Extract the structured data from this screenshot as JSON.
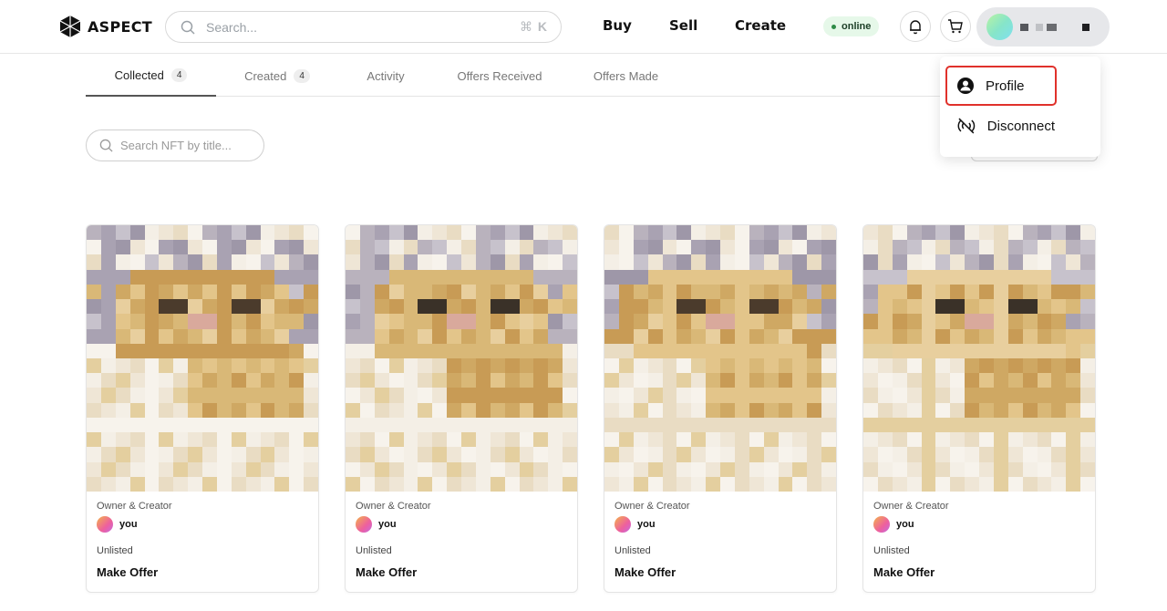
{
  "brand": {
    "name": "ASPECT"
  },
  "search": {
    "placeholder": "Search...",
    "shortcut_symbol": "⌘",
    "shortcut_key": "K"
  },
  "nav": {
    "buy": "Buy",
    "sell": "Sell",
    "create": "Create"
  },
  "status": {
    "label": "online",
    "color": "#2e8b46"
  },
  "account": {
    "avatar_gradient": [
      "#b9f3a3",
      "#7ee0f0"
    ]
  },
  "tabs": [
    {
      "label": "Collected",
      "count": "4",
      "active": true
    },
    {
      "label": "Created",
      "count": "4"
    },
    {
      "label": "Activity"
    },
    {
      "label": "Offers Received"
    },
    {
      "label": "Offers Made"
    }
  ],
  "nft_search": {
    "placeholder": "Search NFT by title..."
  },
  "account_menu": {
    "items": [
      {
        "label": "Profile",
        "icon": "user-circle-icon"
      },
      {
        "label": "Disconnect",
        "icon": "disconnect-icon"
      }
    ],
    "highlight_color": "#e0312b"
  },
  "cards": [
    {
      "owner_label": "Owner & Creator",
      "owner_name": "you",
      "listing": "Unlisted",
      "action": "Make Offer"
    },
    {
      "owner_label": "Owner & Creator",
      "owner_name": "you",
      "listing": "Unlisted",
      "action": "Make Offer"
    },
    {
      "owner_label": "Owner & Creator",
      "owner_name": "you",
      "listing": "Unlisted",
      "action": "Make Offer"
    },
    {
      "owner_label": "Owner & Creator",
      "owner_name": "you",
      "listing": "Unlisted",
      "action": "Make Offer"
    }
  ]
}
